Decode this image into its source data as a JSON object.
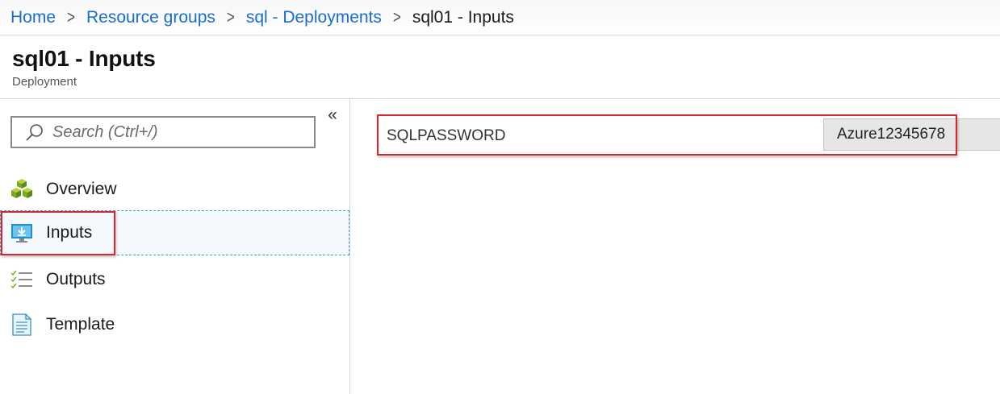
{
  "breadcrumb": {
    "items": [
      {
        "label": "Home"
      },
      {
        "label": "Resource groups"
      },
      {
        "label": "sql - Deployments"
      }
    ],
    "current": "sql01 - Inputs",
    "separator": ">"
  },
  "header": {
    "title": "sql01 - Inputs",
    "subtitle": "Deployment"
  },
  "sidebar": {
    "collapse_glyph": "«",
    "search": {
      "placeholder": "Search (Ctrl+/)",
      "value": ""
    },
    "items": [
      {
        "label": "Overview",
        "icon": "overview-cubes-icon",
        "selected": false
      },
      {
        "label": "Inputs",
        "icon": "inputs-monitor-icon",
        "selected": true
      },
      {
        "label": "Outputs",
        "icon": "outputs-checklist-icon",
        "selected": false
      },
      {
        "label": "Template",
        "icon": "template-document-icon",
        "selected": false
      }
    ]
  },
  "main": {
    "parameters": [
      {
        "name": "SQLPASSWORD",
        "value": "Azure12345678"
      }
    ]
  },
  "colors": {
    "link": "#1a6dcc",
    "highlight": "#d9262c",
    "selected_bg": "#f3f9fd",
    "selected_border": "#3aa0c8"
  }
}
